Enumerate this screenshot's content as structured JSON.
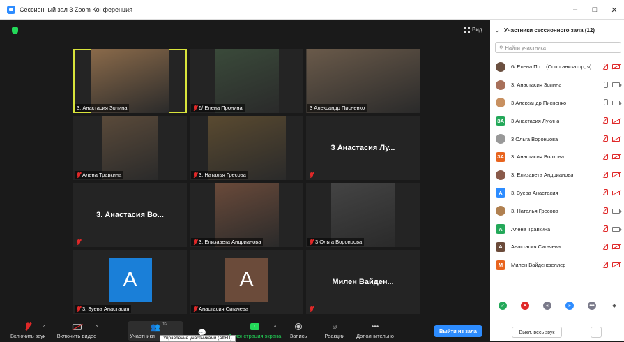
{
  "window": {
    "title": "Сессионный зал 3  Zoom Конференция",
    "minimize": "–",
    "maximize": "□",
    "close": "✕"
  },
  "view_label": "Вид",
  "tiles": [
    {
      "name": "3. Анастасия Золина",
      "label_type": "plain",
      "active": true,
      "bg": "#8a6a4a",
      "muted": false
    },
    {
      "name": "6/ Елена Пронина",
      "label_type": "plain",
      "bg": "#3a4a3a",
      "muted": true
    },
    {
      "name": "3 Александр Писненко",
      "label_type": "plain",
      "bg": "#6a5a4a",
      "muted": false
    },
    {
      "name": "Алена Травкина",
      "label_type": "plain",
      "bg": "#5a4a3a",
      "muted": true
    },
    {
      "name": "3. Наталья Гресова",
      "label_type": "plain",
      "bg": "#5a4a30",
      "muted": true
    },
    {
      "name": "",
      "big_name": "3 Анастасия Лу...",
      "label_type": "big",
      "muted": true
    },
    {
      "name": "",
      "big_name": "3. Анастасия Во...",
      "label_type": "big",
      "muted": true
    },
    {
      "name": "3. Елизавета Андрианова",
      "label_type": "plain",
      "bg": "#6a4a3a",
      "muted": true
    },
    {
      "name": "3 Ольга Воронцова",
      "label_type": "plain",
      "bg": "#444",
      "muted": true
    },
    {
      "name": "3. Зуева Анастасия",
      "label_type": "avatar",
      "letter": "A",
      "avatar_color": "#1a7fd8",
      "muted": true
    },
    {
      "name": "Анастасия Сигачева",
      "label_type": "avatar",
      "letter": "A",
      "avatar_color": "#6b4b3a",
      "muted": true
    },
    {
      "name": "",
      "big_name": "Милен  Вайден...",
      "label_type": "big",
      "muted": true
    }
  ],
  "toolbar": {
    "mute": "Включить звук",
    "video": "Включить видео",
    "participants": "Участники",
    "participants_count": "12",
    "share": "Демонстрация экрана",
    "record": "Запись",
    "reactions": "Реакции",
    "more": "Дополнительно",
    "leave": "Выйти из зала",
    "tooltip": "Управление участниками (Alt+U)"
  },
  "panel": {
    "title": "Участники сессионного зала (12)",
    "search_placeholder": "Найти участника",
    "participants": [
      {
        "name": "6/ Елена Пр...  (Соорганизатор, я)",
        "avatar": "photo",
        "color": "#6b5040",
        "letter": "",
        "mic": "off",
        "cam": "off"
      },
      {
        "name": "3. Анастасия Золина",
        "avatar": "photo",
        "color": "#a8705a",
        "letter": "",
        "mic": "on",
        "cam": "on"
      },
      {
        "name": "3 Александр Писненко",
        "avatar": "photo",
        "color": "#c89060",
        "letter": "",
        "mic": "on",
        "cam": "on"
      },
      {
        "name": "3 Анастасия Лукина",
        "avatar": "letter",
        "color": "#23a859",
        "letter": "ЗА",
        "mic": "off",
        "cam": "off"
      },
      {
        "name": "3 Ольга Воронцова",
        "avatar": "photo",
        "color": "#999",
        "letter": "",
        "mic": "off",
        "cam": "off"
      },
      {
        "name": "3. Анастасия Волкова",
        "avatar": "letter",
        "color": "#e8641e",
        "letter": "ЗА",
        "mic": "off",
        "cam": "off"
      },
      {
        "name": "3. Елизавета Андрианова",
        "avatar": "photo",
        "color": "#8a5a4a",
        "letter": "",
        "mic": "off",
        "cam": "off"
      },
      {
        "name": "3. Зуева Анастасия",
        "avatar": "letter",
        "color": "#2d8cff",
        "letter": "A",
        "mic": "off",
        "cam": "off"
      },
      {
        "name": "3. Наталья Гресова",
        "avatar": "photo",
        "color": "#b08050",
        "letter": "",
        "mic": "off",
        "cam": "on"
      },
      {
        "name": "Алена Травкина",
        "avatar": "letter",
        "color": "#23a859",
        "letter": "A",
        "mic": "off",
        "cam": "on"
      },
      {
        "name": "Анастасия Сигачева",
        "avatar": "letter",
        "color": "#6b4b3a",
        "letter": "A",
        "mic": "off",
        "cam": "off"
      },
      {
        "name": "Милен Вайденфеллер",
        "avatar": "letter",
        "color": "#e8641e",
        "letter": "M",
        "mic": "off",
        "cam": "off"
      }
    ],
    "reactions": [
      {
        "name": "yes-icon",
        "color": "#23a859",
        "glyph": "✓"
      },
      {
        "name": "no-icon",
        "color": "#e02828",
        "glyph": "✕"
      },
      {
        "name": "go-slower-icon",
        "color": "#7a7a8a",
        "glyph": "«"
      },
      {
        "name": "go-faster-icon",
        "color": "#2d8cff",
        "glyph": "»"
      },
      {
        "name": "more-reactions-icon",
        "color": "#7a7a8a",
        "glyph": "•••"
      },
      {
        "name": "clear-icon",
        "color": "#555",
        "glyph": "◆"
      }
    ],
    "mute_all": "Выкл. весь звук",
    "more": "..."
  }
}
